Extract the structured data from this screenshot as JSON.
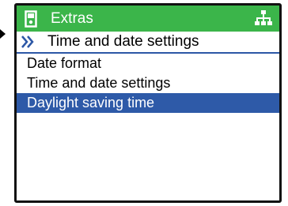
{
  "window": {
    "title": "Extras"
  },
  "breadcrumb": {
    "label": "Time and date settings"
  },
  "menu": {
    "items": [
      {
        "label": "Date format",
        "selected": false
      },
      {
        "label": "Time and date settings",
        "selected": false
      },
      {
        "label": "Daylight saving time",
        "selected": true
      }
    ]
  },
  "colors": {
    "titlebar": "#3bb54a",
    "selection": "#2e5aa8",
    "breadcrumb_line": "#2c57a6"
  },
  "icons": {
    "title": "device-icon",
    "network": "network-icon",
    "breadcrumb": "double-chevron-icon",
    "pointer": "pointer-arrow-icon"
  }
}
